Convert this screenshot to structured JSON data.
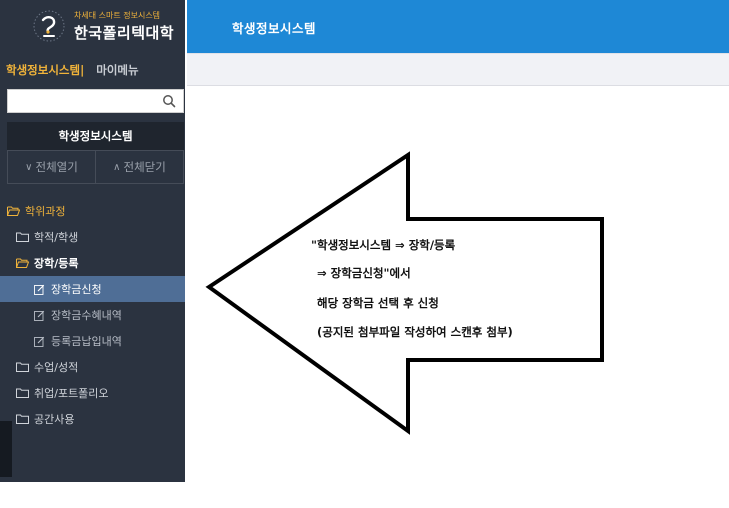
{
  "logo": {
    "subtitle": "차세대 스마트 정보시스템",
    "name": "한국폴리텍대학"
  },
  "system_tabs": {
    "active": "학생정보시스템",
    "separator": "|",
    "other": "마이메뉴"
  },
  "search": {
    "value": "",
    "placeholder": ""
  },
  "section_title": "학생정보시스템",
  "toggles": {
    "expand_all": "전체열기",
    "collapse_all": "전체닫기"
  },
  "menu": {
    "degree_course": "학위과정",
    "academic_records": "학적/학생",
    "scholarship_registration": "장학/등록",
    "scholarship_apply": "장학금신청",
    "scholarship_history": "장학금수혜내역",
    "tuition_payment": "등록금납입내역",
    "classes_grades": "수업/성적",
    "employment_portfolio": "취업/포트폴리오",
    "space_usage": "공간사용"
  },
  "header": {
    "title": "학생정보시스템"
  },
  "annotation": {
    "line1": "\"학생정보시스템 ⇒ 장학/등록",
    "line2": "⇒ 장학금신청\"에서",
    "line3": "해당 장학금 선택 후 신청",
    "line4": "(공지된 첨부파일 작성하여 스캔후 첨부)"
  },
  "colors": {
    "sidebar_bg": "#2b3340",
    "header_bg": "#1e88d6",
    "accent_gold": "#f0b33a",
    "selected_item": "#4f6e96"
  }
}
